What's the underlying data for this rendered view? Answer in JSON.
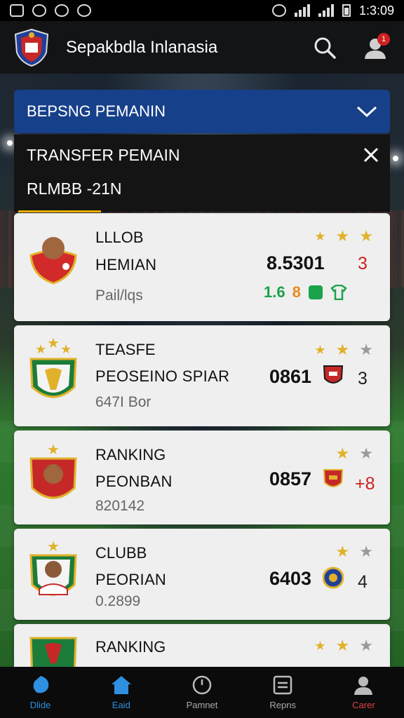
{
  "status_bar": {
    "time": "1:3:09"
  },
  "app": {
    "title": "Sepakbdla Inlanasia",
    "notification_count": "1"
  },
  "dropdown": {
    "label": "BEPSNG PEMANIN"
  },
  "transfer_panel": {
    "title": "TRANSFER PEMAIN",
    "subtitle": "RLMBB -21N"
  },
  "cards": [
    {
      "line1": "LLLOB",
      "line2": "HEMIAN",
      "line3": "Pail/lqs",
      "score": "8.5301",
      "right_num": "3",
      "stats": [
        "1.6",
        "8"
      ]
    },
    {
      "line1": "TEASFE",
      "line2": "PEOSEINO SPIAR",
      "line3": "647I Bor",
      "score": "0861",
      "right_num": "3"
    },
    {
      "line1": "RANKING",
      "line2": "PEONBAN",
      "line3": "820142",
      "score": "0857",
      "right_num": "+8"
    },
    {
      "line1": "CLUBB",
      "line2": "PEORIAN",
      "line3": "0.2899",
      "score": "6403",
      "right_num": "4"
    },
    {
      "line1": "RANKING",
      "line2": "",
      "line3": "",
      "score": "",
      "right_num": ""
    }
  ],
  "bottom_nav": [
    {
      "label": "Dlide",
      "icon": "sports-icon",
      "color": "#2f8fe0"
    },
    {
      "label": "Eaid",
      "icon": "home-icon",
      "color": "#2f8fe0"
    },
    {
      "label": "Pamnet",
      "icon": "clock-icon",
      "color": "#bbbbbb"
    },
    {
      "label": "Repns",
      "icon": "list-icon",
      "color": "#bbbbbb"
    },
    {
      "label": "Carer",
      "icon": "profile-icon",
      "color": "#e04040"
    }
  ],
  "colors": {
    "accent_blue": "#17408a",
    "gold": "#e0b22a",
    "red": "#cc2222",
    "green": "#1aa34a"
  }
}
